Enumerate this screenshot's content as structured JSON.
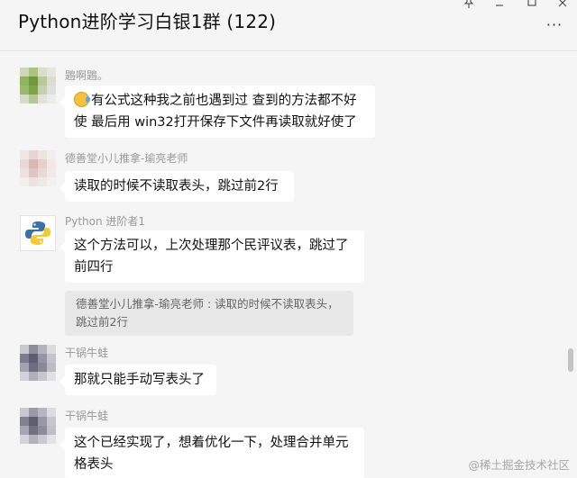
{
  "header": {
    "title": "Python进阶学习白银1群 (122)",
    "pin_icon": "pin-icon",
    "minimize_icon": "minimize-icon",
    "maximize_icon": "maximize-icon",
    "close_icon": "close-icon",
    "more_label": "···"
  },
  "messages": [
    {
      "sender": "鶗啊鶗。",
      "emoji": "sweat-smile-emoji",
      "lines": [
        "有公式这种我之前也遇到过 查到的方法都不好",
        "使  最后用 win32打开保存下文件再读取就好使了"
      ]
    },
    {
      "sender": "德善堂小儿推拿-瑜亮老师",
      "lines": [
        "读取的时候不读取表头，跳过前2行"
      ]
    },
    {
      "sender": "Python 进阶者1",
      "lines": [
        "这个方法可以，上次处理那个民评议表，跳过了",
        "前四行"
      ],
      "quote": [
        "德善堂小儿推拿-瑜亮老师 : 读取的时候不读取表头，",
        "跳过前2行"
      ]
    },
    {
      "sender": "干锅牛蛙",
      "lines": [
        "那就只能手动写表头了"
      ]
    },
    {
      "sender": "干锅牛蛙",
      "lines": [
        "这个已经实现了，想着优化一下，处理合并单元",
        "格表头"
      ]
    }
  ],
  "watermark": "@稀土掘金技术社区",
  "colors": {
    "background": "#f5f5f5",
    "bubble": "#ffffff",
    "quote_bg": "#e8e8e8",
    "sender_text": "#9a9a9a"
  }
}
